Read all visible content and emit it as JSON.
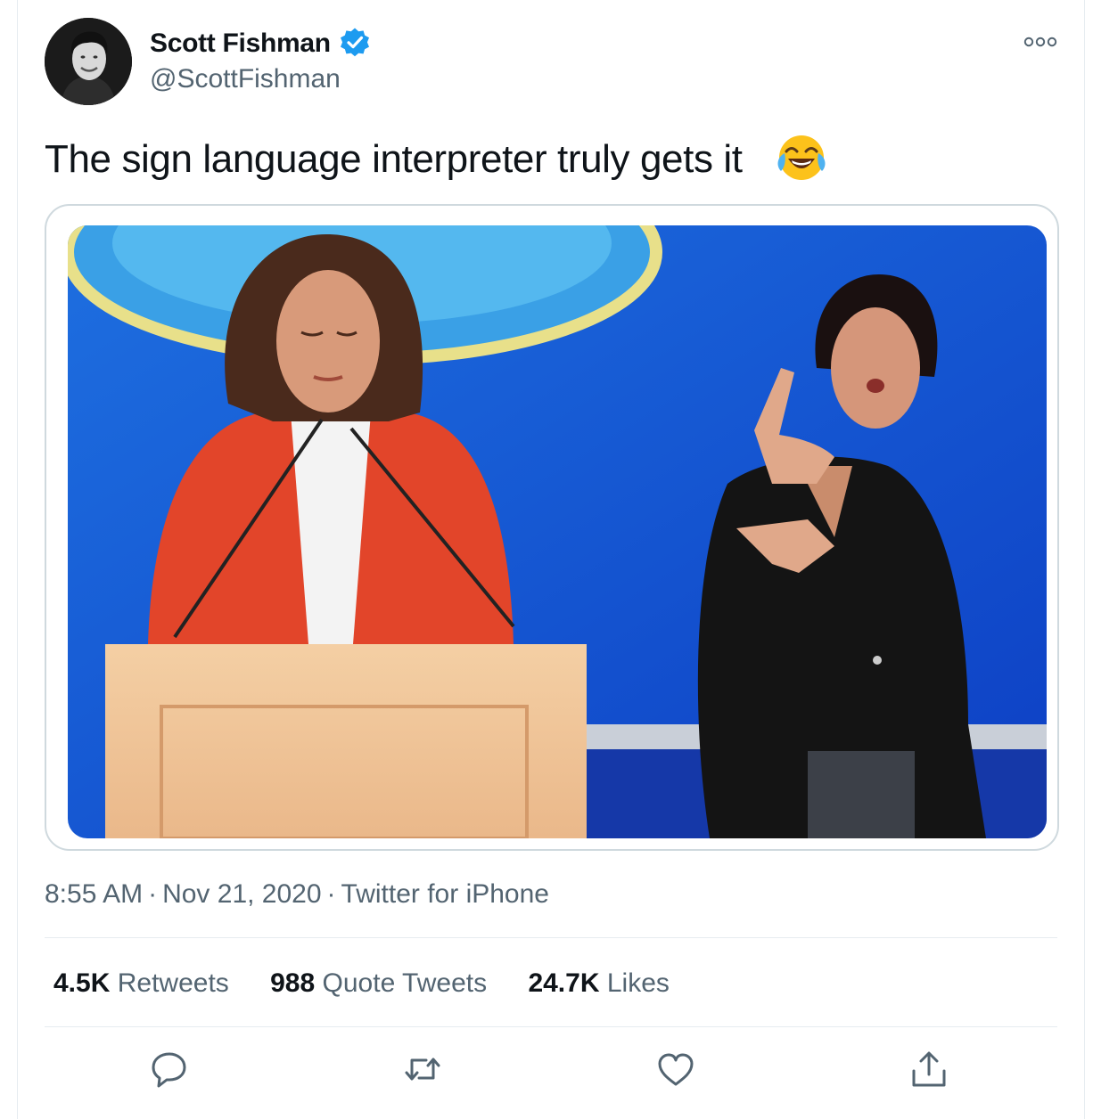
{
  "author": {
    "display_name": "Scott Fishman",
    "handle": "@ScottFishman",
    "verified": true,
    "avatar_icon": "profile-photo"
  },
  "tweet": {
    "text": "The sign language interpreter truly gets it",
    "emoji": "face-with-tears-of-joy",
    "media_icon": "photo-podium-speaker-and-sign-language-interpreter"
  },
  "meta": {
    "time": "8:55 AM",
    "separator": "·",
    "date": "Nov 21, 2020",
    "source": "Twitter for iPhone"
  },
  "stats": [
    {
      "value": "4.5K",
      "label": "Retweets"
    },
    {
      "value": "988",
      "label": "Quote Tweets"
    },
    {
      "value": "24.7K",
      "label": "Likes"
    }
  ],
  "actions": [
    "reply-icon",
    "retweet-icon",
    "like-icon",
    "share-icon"
  ],
  "colors": {
    "text": "#0f1419",
    "secondary": "#536471",
    "border": "#cfd9de",
    "divider": "#e6ecf0",
    "verified": "#1d9bf0"
  }
}
